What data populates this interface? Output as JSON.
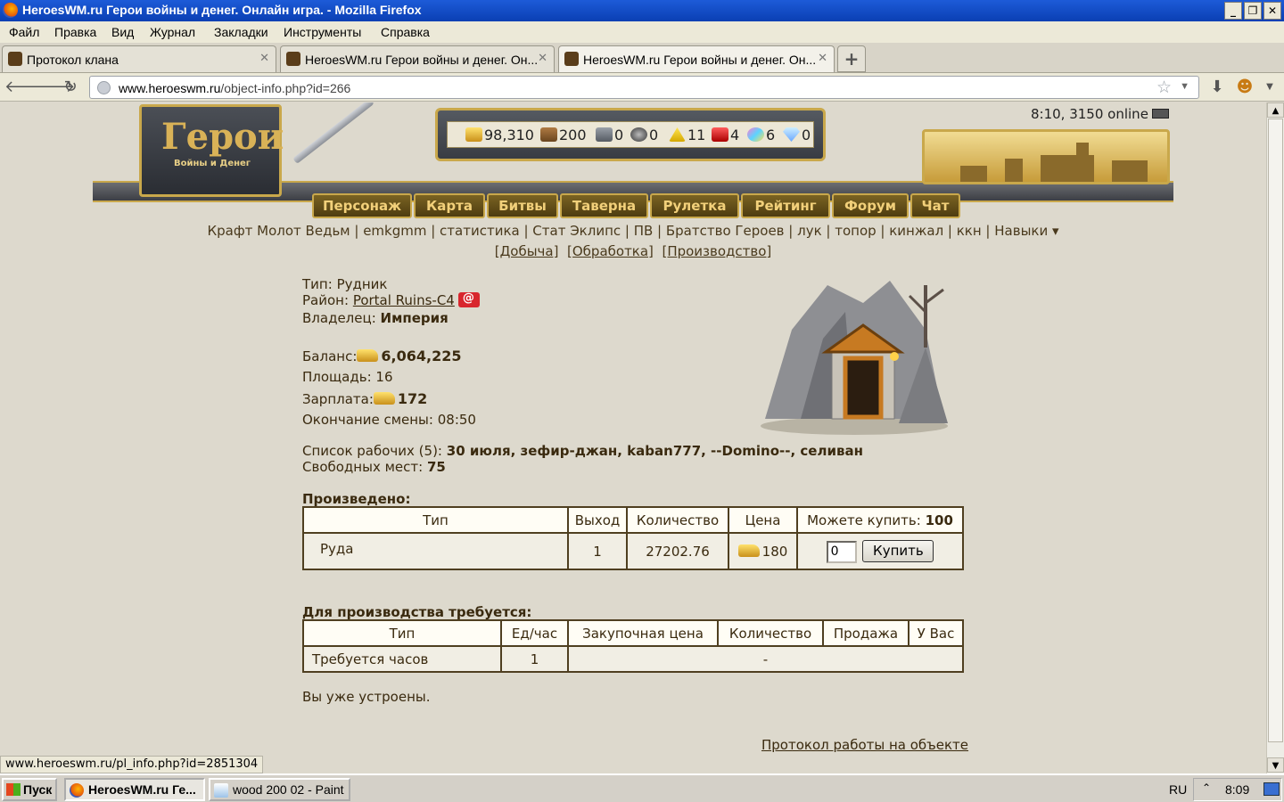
{
  "window": {
    "title": "HeroesWM.ru Герои войны и денег. Онлайн игра. - Mozilla Firefox"
  },
  "menu": [
    "Файл",
    "Правка",
    "Вид",
    "Журнал",
    "Закладки",
    "Инструменты",
    "Справка"
  ],
  "tabs": [
    {
      "label": "Протокол клана",
      "active": false
    },
    {
      "label": "HeroesWM.ru Герои войны и денег. Он...",
      "active": false
    },
    {
      "label": "HeroesWM.ru Герои войны и денег. Он...",
      "active": true
    }
  ],
  "address": {
    "domain": "www.heroeswm.ru",
    "path": "/object-info.php?id=266"
  },
  "header": {
    "logo_big": "Герои",
    "logo_small": "Войны и Денег",
    "resources": [
      {
        "icon": "gold-icon",
        "value": "98,310"
      },
      {
        "icon": "wood-icon",
        "value": "200"
      },
      {
        "icon": "ore-icon",
        "value": "0"
      },
      {
        "icon": "mercury-icon",
        "value": "0"
      },
      {
        "icon": "sulfur-icon",
        "value": "11"
      },
      {
        "icon": "crystal-icon",
        "value": "4"
      },
      {
        "icon": "gems-icon",
        "value": "6"
      },
      {
        "icon": "diamond-icon",
        "value": "0"
      }
    ],
    "online": "8:10, 3150 online",
    "nav": [
      "Персонаж",
      "Карта",
      "Битвы",
      "Таверна",
      "Рулетка",
      "Рейтинг",
      "Форум",
      "Чат"
    ]
  },
  "sublinks": "Крафт Молот Ведьм | emkgmm | статистика | Стат Эклипс | ПВ | Братство Героев | лук | топор | кинжал | ккн |  Навыки ▾",
  "sublinks2": [
    "[Добыча]",
    "[Обработка]",
    "[Производство]"
  ],
  "object": {
    "type_label": "Тип:",
    "type_value": "Рудник",
    "district_label": "Район:",
    "district_value": "Portal Ruins-C4",
    "owner_label": "Владелец:",
    "owner_value": "Империя",
    "balance_label": "Баланс:",
    "balance_value": "6,064,225",
    "area_label": "Площадь:",
    "area_value": "16",
    "salary_label": "Зарплата:",
    "salary_value": "172",
    "shift_end_label": "Окончание смены:",
    "shift_end_value": "08:50",
    "workers_label": "Список рабочих (5):",
    "workers_value": "30 июля, зефир-джан, kaban777, --Domino--, селиван",
    "free_label": "Свободных мест:",
    "free_value": "75"
  },
  "produced": {
    "title": "Произведено:",
    "headers": [
      "Тип",
      "Выход",
      "Количество",
      "Цена",
      "Можете купить:"
    ],
    "can_buy_value": "100",
    "row": {
      "type": "Руда",
      "output": "1",
      "quantity": "27202.76",
      "price": "180",
      "input_value": "0",
      "buy_label": "Купить"
    }
  },
  "required": {
    "title": "Для производства требуется:",
    "headers": [
      "Тип",
      "Ед/час",
      "Закупочная цена",
      "Количество",
      "Продажа",
      "У Вас"
    ],
    "row": {
      "type": "Требуется часов",
      "per_hour": "1",
      "rest": "-"
    }
  },
  "employed_note": "Вы уже устроены.",
  "protocol_link": "Протокол работы на объекте",
  "statusbar": "www.heroeswm.ru/pl_info.php?id=2851304",
  "taskbar": {
    "start": "Пуск",
    "items": [
      {
        "label": "HeroesWM.ru Ге...",
        "active": true
      },
      {
        "label": "wood 200 02 - Paint",
        "active": false
      }
    ],
    "lang": "RU",
    "clock": "8:09"
  }
}
